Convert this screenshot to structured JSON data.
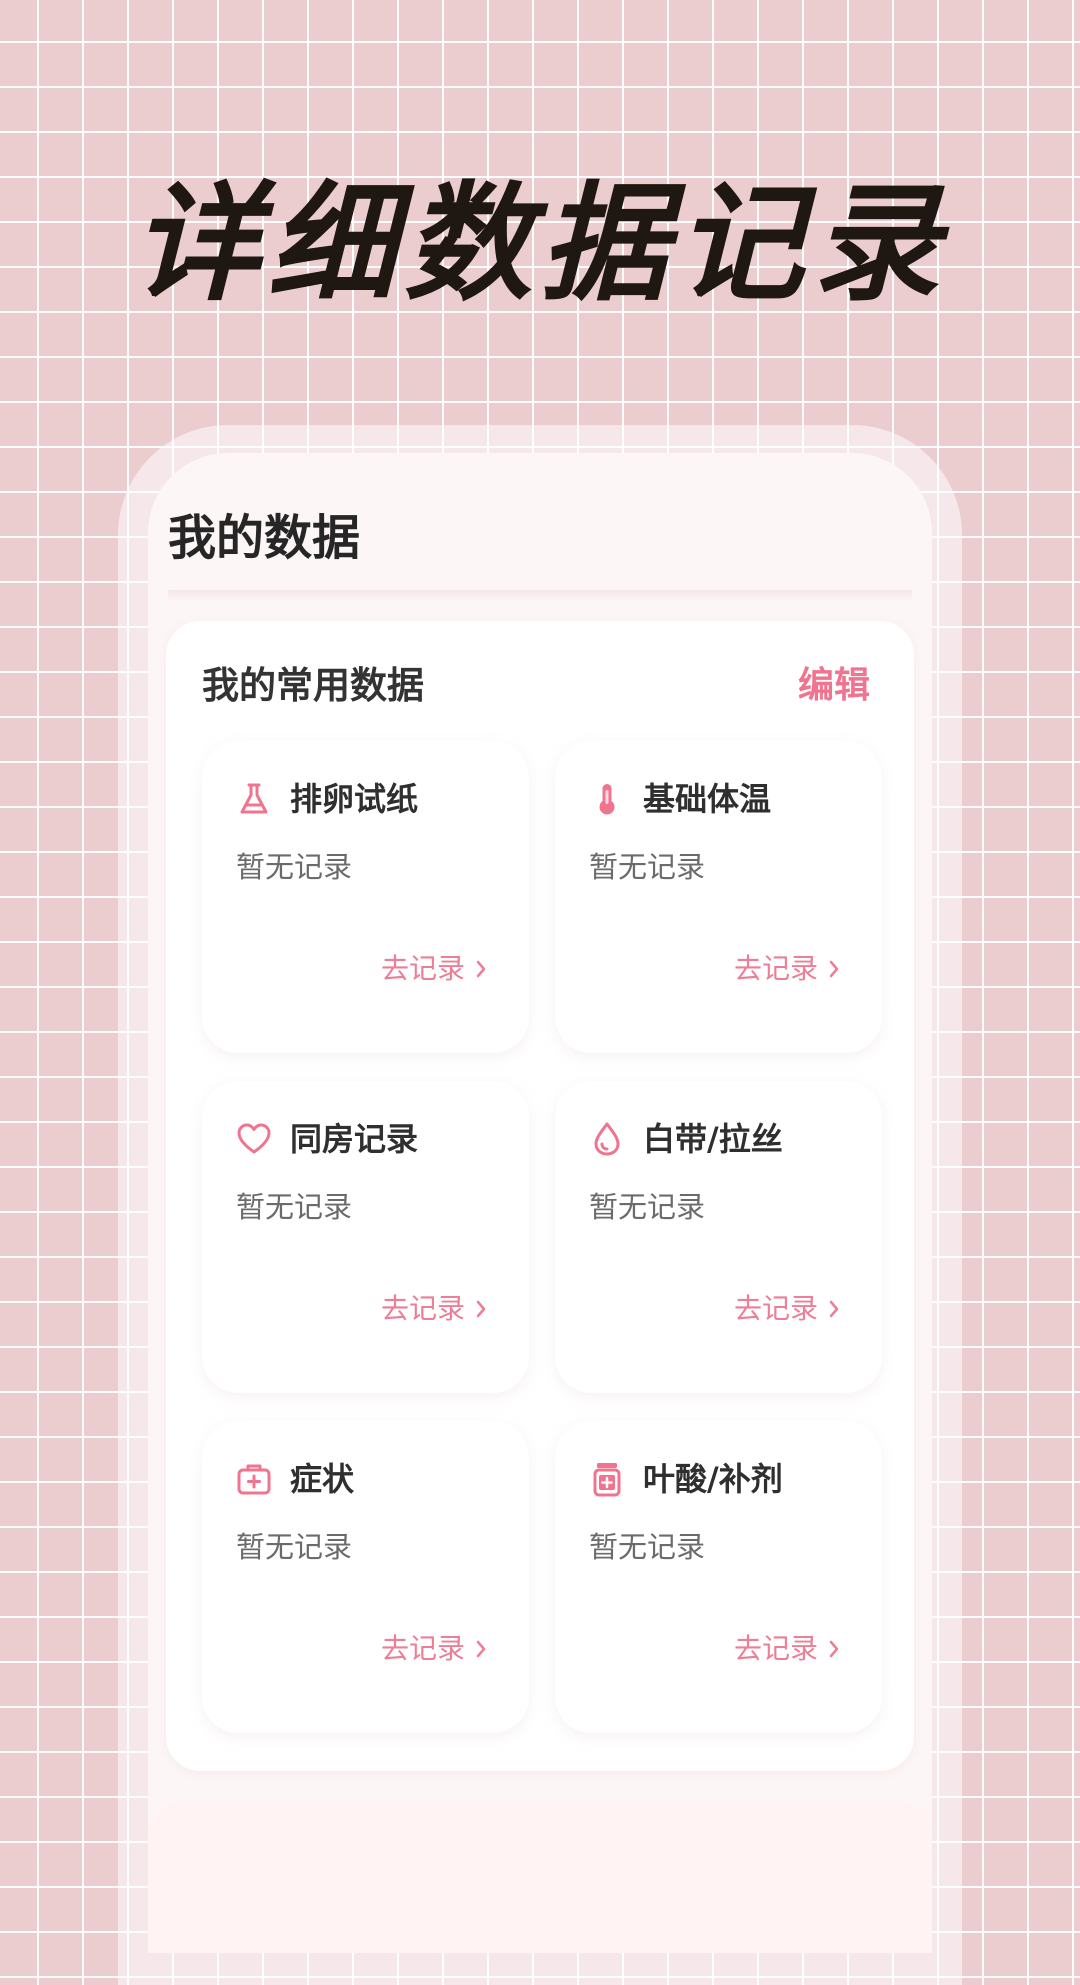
{
  "hero": {
    "title": "详细数据记录"
  },
  "screen": {
    "title": "我的数据"
  },
  "common_data": {
    "title": "我的常用数据",
    "edit_label": "编辑",
    "items": [
      {
        "name": "排卵试纸",
        "status": "暂无记录",
        "action": "去记录",
        "icon": "flask-icon"
      },
      {
        "name": "基础体温",
        "status": "暂无记录",
        "action": "去记录",
        "icon": "thermometer-icon"
      },
      {
        "name": "同房记录",
        "status": "暂无记录",
        "action": "去记录",
        "icon": "heart-icon"
      },
      {
        "name": "白带/拉丝",
        "status": "暂无记录",
        "action": "去记录",
        "icon": "droplet-icon"
      },
      {
        "name": "症状",
        "status": "暂无记录",
        "action": "去记录",
        "icon": "medical-kit-icon"
      },
      {
        "name": "叶酸/补剂",
        "status": "暂无记录",
        "action": "去记录",
        "icon": "pill-bottle-icon"
      }
    ]
  },
  "colors": {
    "accent": "#f0748f",
    "background": "#ebcdd0",
    "title_text": "#1f1711"
  }
}
